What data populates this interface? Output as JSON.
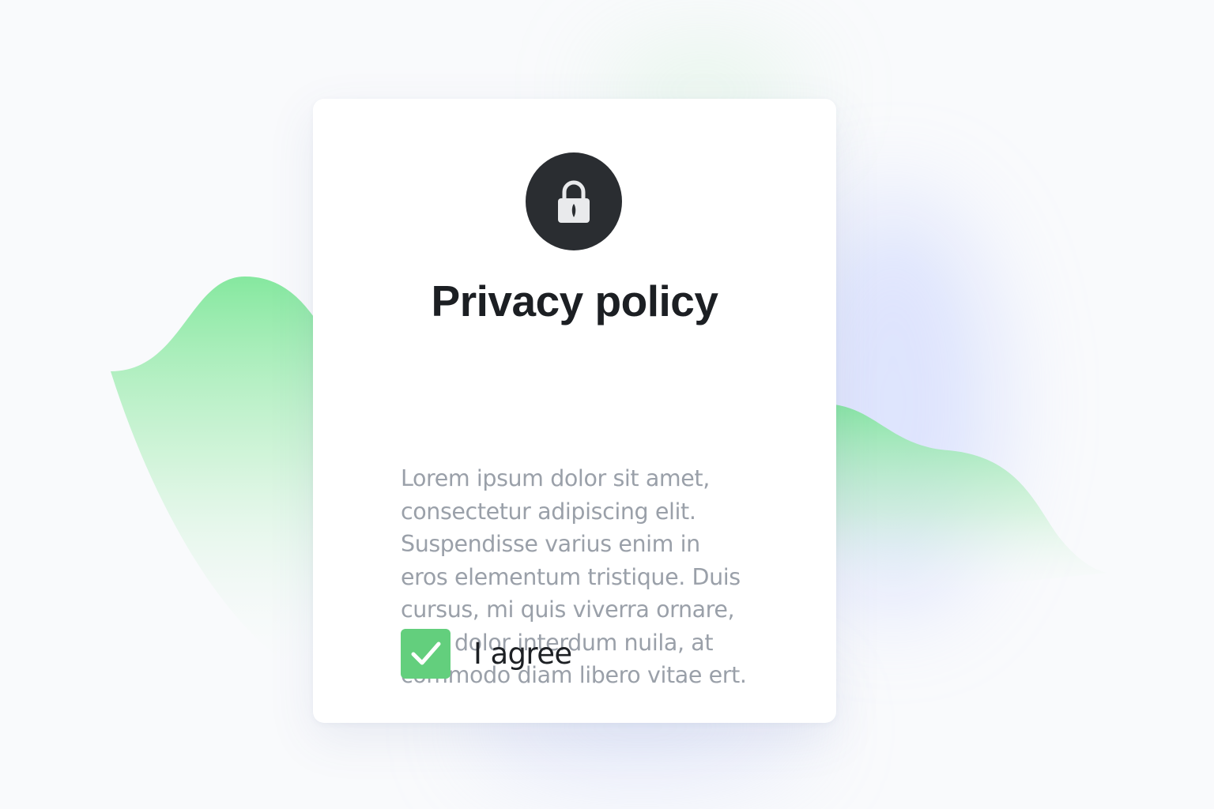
{
  "dialog": {
    "title": "Privacy policy",
    "icon": "lock-icon",
    "body_lines": [
      "Lorem ipsum dolor sit amet,",
      "consectetur adipiscing elit.",
      "Suspendisse varius enim in",
      "eros elementum tristique. Duis",
      "cursus, mi quis viverra ornare,",
      "eros dolor interdum nuila, at",
      "commodo diam libero vitae ert."
    ],
    "agree": {
      "label": "I agree",
      "checked": true,
      "check_icon": "checkmark-icon"
    }
  },
  "colors": {
    "accent_green": "#63cf7d",
    "lock_badge": "#2a2d31",
    "title": "#1c1f23",
    "body_text": "#9aa0a9",
    "card": "#ffffff",
    "background": "#f9fafc"
  }
}
